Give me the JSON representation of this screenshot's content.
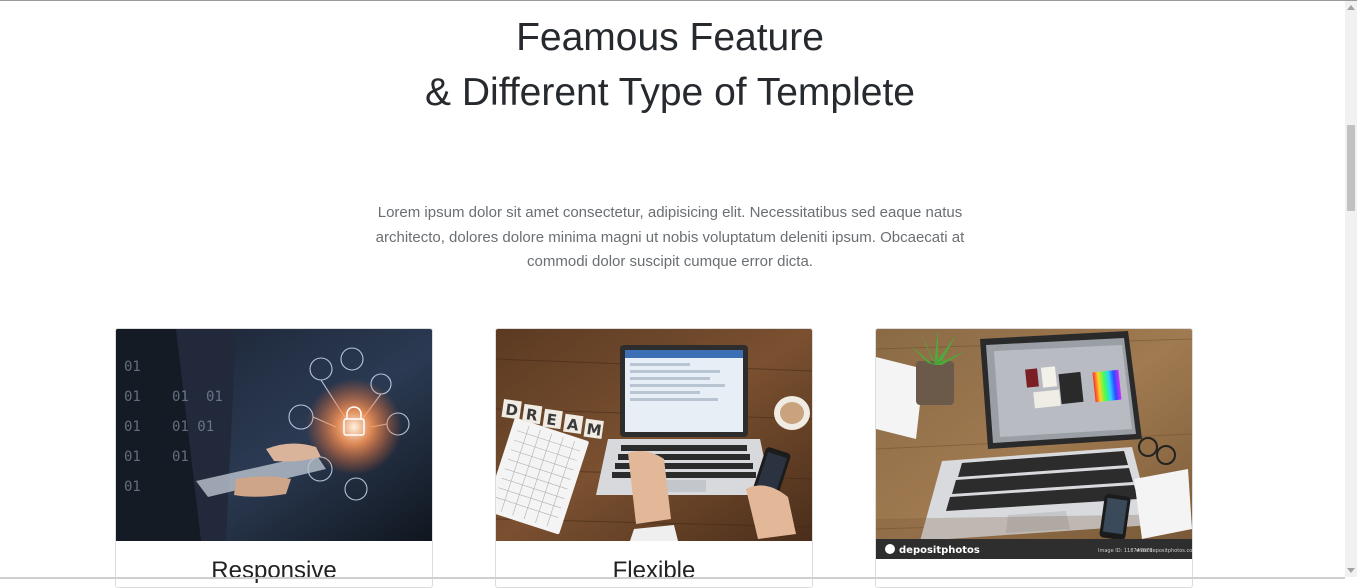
{
  "section": {
    "heading_line1": "Feamous Feature",
    "heading_line2": "& Different Type of Templete",
    "description": "Lorem ipsum dolor sit amet consectetur, adipisicing elit. Necessitatibus sed eaque natus architecto, dolores dolore minima magni ut nobis voluptatum deleniti ipsum. Obcaecati at commodi dolor suscipit cumque error dicta."
  },
  "cards": [
    {
      "title": "Responsive",
      "image": "digital-security-touchscreen"
    },
    {
      "title": "Flexible",
      "image": "laptop-desk-dream"
    },
    {
      "title": "",
      "image": "laptop-design-mockup",
      "watermark": "depositphotos",
      "stock_id": "Image ID: 118747079",
      "stock_url": "www.depositphotos.com"
    }
  ],
  "colors": {
    "heading": "#262a2e",
    "text": "#6a6f73",
    "card_border": "#dcdcdc"
  }
}
